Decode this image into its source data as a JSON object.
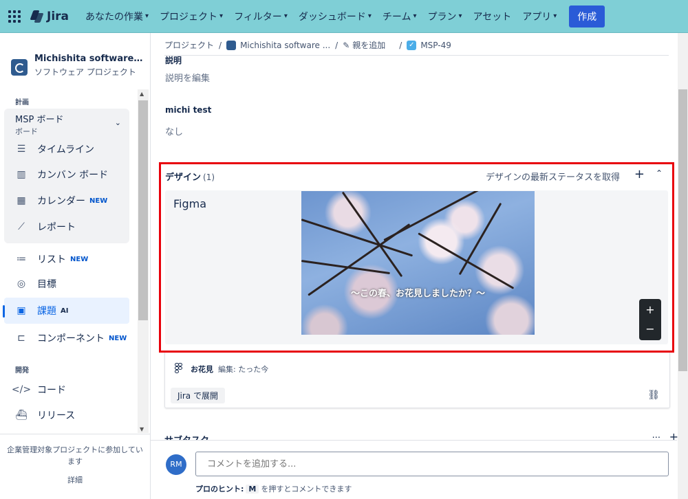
{
  "nav": {
    "logo": "Jira",
    "items": [
      {
        "label": "あなたの作業"
      },
      {
        "label": "プロジェクト"
      },
      {
        "label": "フィルター"
      },
      {
        "label": "ダッシュボード"
      },
      {
        "label": "チーム"
      },
      {
        "label": "プラン"
      },
      {
        "label": "アセット"
      },
      {
        "label": "アプリ"
      }
    ],
    "create_label": "作成"
  },
  "sidebar": {
    "project_name": "Michishita software proj...",
    "project_type": "ソフトウェア プロジェクト",
    "plan_section": "計画",
    "board_title": "MSP ボード",
    "board_sub": "ボード",
    "items": [
      {
        "label": "タイムライン"
      },
      {
        "label": "カンバン ボード"
      },
      {
        "label": "カレンダー",
        "badge": "NEW"
      },
      {
        "label": "レポート"
      },
      {
        "label": "リスト",
        "badge": "NEW"
      },
      {
        "label": "目標"
      },
      {
        "label": "課題",
        "badge": "AI"
      },
      {
        "label": "コンポーネント",
        "badge": "NEW"
      }
    ],
    "dev_section": "開発",
    "dev_items": [
      {
        "label": "コード"
      },
      {
        "label": "リリース"
      }
    ],
    "footer_text": "企業管理対象プロジェクトに参加しています",
    "footer_link": "詳細"
  },
  "breadcrumb": {
    "root": "プロジェクト",
    "project": "Michishita software ...",
    "add_parent": "親を追加",
    "issue_key": "MSP-49"
  },
  "fields": {
    "description_label": "説明",
    "description_value": "説明を編集",
    "custom_label": "michi test",
    "custom_value": "なし"
  },
  "design": {
    "title": "デザイン",
    "count": "(1)",
    "status_link": "デザインの最新ステータスを取得",
    "figma_label": "Figma",
    "caption": "〜この春、お花見しましたか？〜",
    "file_name": "お花見",
    "edited": "編集: たった今",
    "expand_label": "Jira で展開"
  },
  "subtask": {
    "label": "サブタスク"
  },
  "comment": {
    "avatar": "RM",
    "placeholder": "コメントを追加する...",
    "hint_prefix": "プロのヒント:",
    "hint_key": "M",
    "hint_suffix": "を押すとコメントできます"
  }
}
